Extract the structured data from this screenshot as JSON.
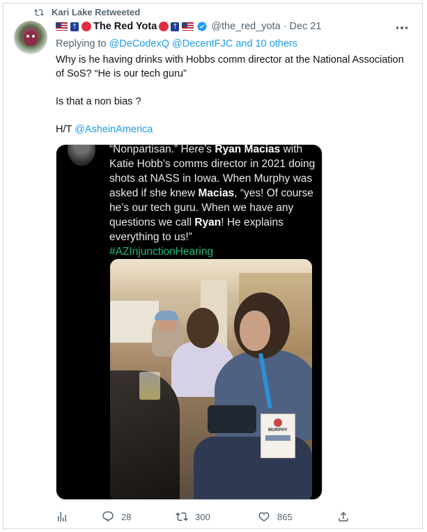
{
  "retweet_banner": {
    "label": "Kari Lake Retweeted"
  },
  "tweet": {
    "display_name": "The Red Yota",
    "handle": "@the_red_yota",
    "separator": "·",
    "date": "Dec 21",
    "reply_prefix": "Replying to",
    "reply_mentions": "@DeCodexQ @DecentFJC and 10 others",
    "text_lines": [
      "Why is he having drinks with Hobbs comm director at the National Association of SoS? “He is our tech guru”",
      "Is that a non bias ?"
    ],
    "hat_tip_prefix": "H/T ",
    "hat_tip_mention": "@AsheinAmerica"
  },
  "embedded_image": {
    "text_seg1": "“Nonpartisan.” Here’s ",
    "bold1": "Ryan Macias",
    "text_seg2": " with Katie Hobb’s comms director in 2021 doing shots at NASS in Iowa. When Murphy was asked if she knew ",
    "bold2": "Macias",
    "text_seg3": ", “yes! Of course he’s our tech guru. When we have any questions we call ",
    "bold3": "Ryan",
    "text_seg4": "! He explains everything to us!”",
    "hashtag": "#AZInjunctionHearing",
    "badge_name": "MURPHY"
  },
  "actions": {
    "replies": "28",
    "retweets": "300",
    "likes": "865"
  },
  "colors": {
    "accent": "#1d9bf0",
    "secondary_text": "#536471",
    "hashtag_green": "#1d9bf0"
  }
}
